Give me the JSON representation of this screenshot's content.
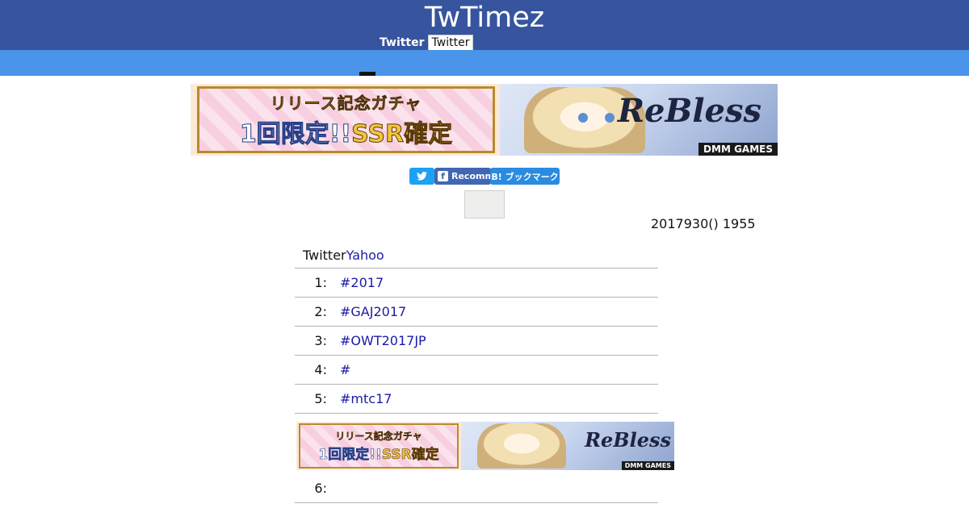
{
  "header": {
    "site_title": "TwTimez",
    "twitter_label": "Twitter",
    "twitter_box": "Twitter"
  },
  "colors": {
    "header_bg": "#37559e",
    "nav_bg": "#4a94ea",
    "link": "#1a1aa6"
  },
  "banner": {
    "gacha_text": "リリース記念ガチャ",
    "limited_text": "1回限定!!",
    "ssr_text": "SSR確定",
    "logo_text": "ReBless",
    "publisher_text": "DMM GAMES"
  },
  "share": {
    "twitter_icon": "twitter-bird-icon",
    "facebook_label": "Recommend",
    "hatena_label": "B! ブックマーク"
  },
  "date_text": "2017930() 1955",
  "trends": {
    "header_prefix": "Twitter",
    "header_link": "Yahoo",
    "items": [
      {
        "rank": "1:",
        "tag": "#2017"
      },
      {
        "rank": "2:",
        "tag": "#GAJ2017"
      },
      {
        "rank": "3:",
        "tag": "#OWT2017JP"
      },
      {
        "rank": "4:",
        "tag": "#"
      },
      {
        "rank": "5:",
        "tag": "#mtc17"
      },
      {
        "rank": "6:",
        "tag": ""
      }
    ]
  }
}
